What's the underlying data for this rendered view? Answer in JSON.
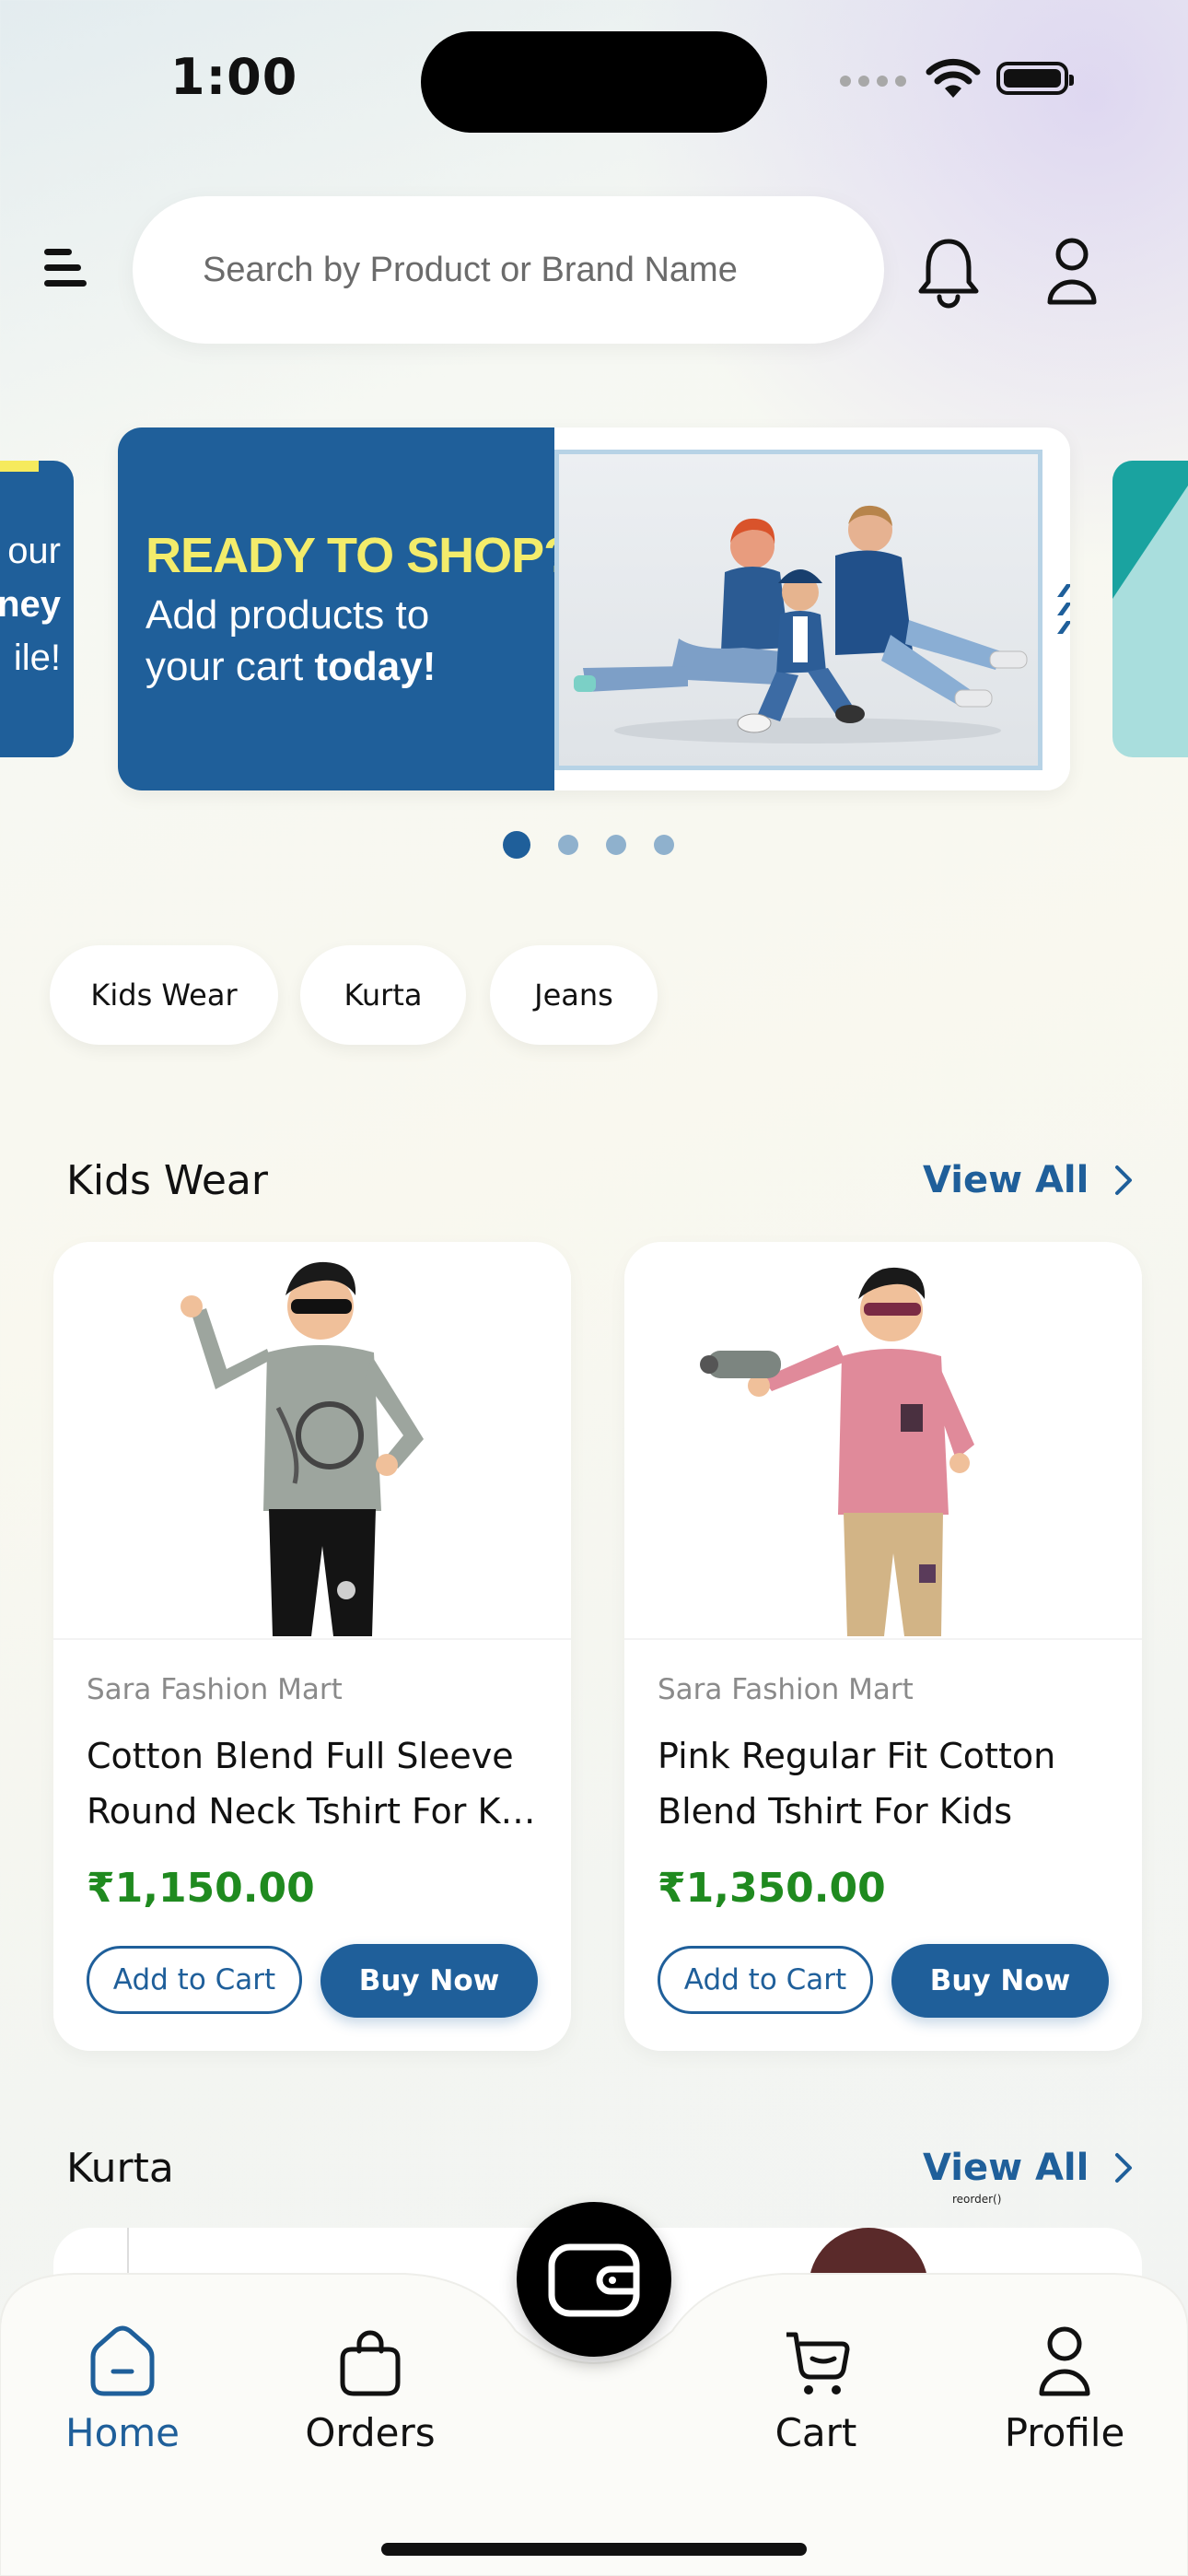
{
  "status_bar": {
    "time": "1:00"
  },
  "search": {
    "placeholder": "Search by Product or Brand Name"
  },
  "header_icons": [
    "menu-icon",
    "bell-icon",
    "user-icon"
  ],
  "banners": {
    "left_peek": {
      "lines": [
        "our",
        "ney",
        "ile!"
      ]
    },
    "main": {
      "title": "READY TO SHOP?",
      "line1": "Add products to",
      "line2_plain": "your cart ",
      "line2_bold": "today!"
    },
    "count": 4,
    "active_index": 0
  },
  "chips": [
    "Kids Wear",
    "Kurta",
    "Jeans"
  ],
  "sections": [
    {
      "title": "Kids Wear",
      "view_all": "View All",
      "products": [
        {
          "brand": "Sara Fashion Mart",
          "name_line1": "Cotton Blend Full Sleeve",
          "name_line2": "Round Neck Tshirt For Ki…",
          "price": "₹1,150.00",
          "add_to_cart": "Add to Cart",
          "buy_now": "Buy Now"
        },
        {
          "brand": "Sara Fashion Mart",
          "name_line1": "Pink Regular Fit Cotton",
          "name_line2": "Blend Tshirt For Kids",
          "price": "₹1,350.00",
          "add_to_cart": "Add to Cart",
          "buy_now": "Buy Now"
        }
      ]
    },
    {
      "title": "Kurta",
      "view_all": "View All",
      "debug_label": "reorder()"
    }
  ],
  "bottom_nav": {
    "items": [
      {
        "label": "Home",
        "icon": "home-icon",
        "active": true
      },
      {
        "label": "Orders",
        "icon": "bag-icon",
        "active": false
      },
      {
        "label": "Cart",
        "icon": "cart-icon",
        "active": false
      },
      {
        "label": "Profile",
        "icon": "profile-icon",
        "active": false
      }
    ],
    "center_icon": "wallet-icon"
  },
  "colors": {
    "primary": "#1f5f9a",
    "price_green": "#1f8a1f",
    "banner_yellow": "#f3ec6b"
  }
}
